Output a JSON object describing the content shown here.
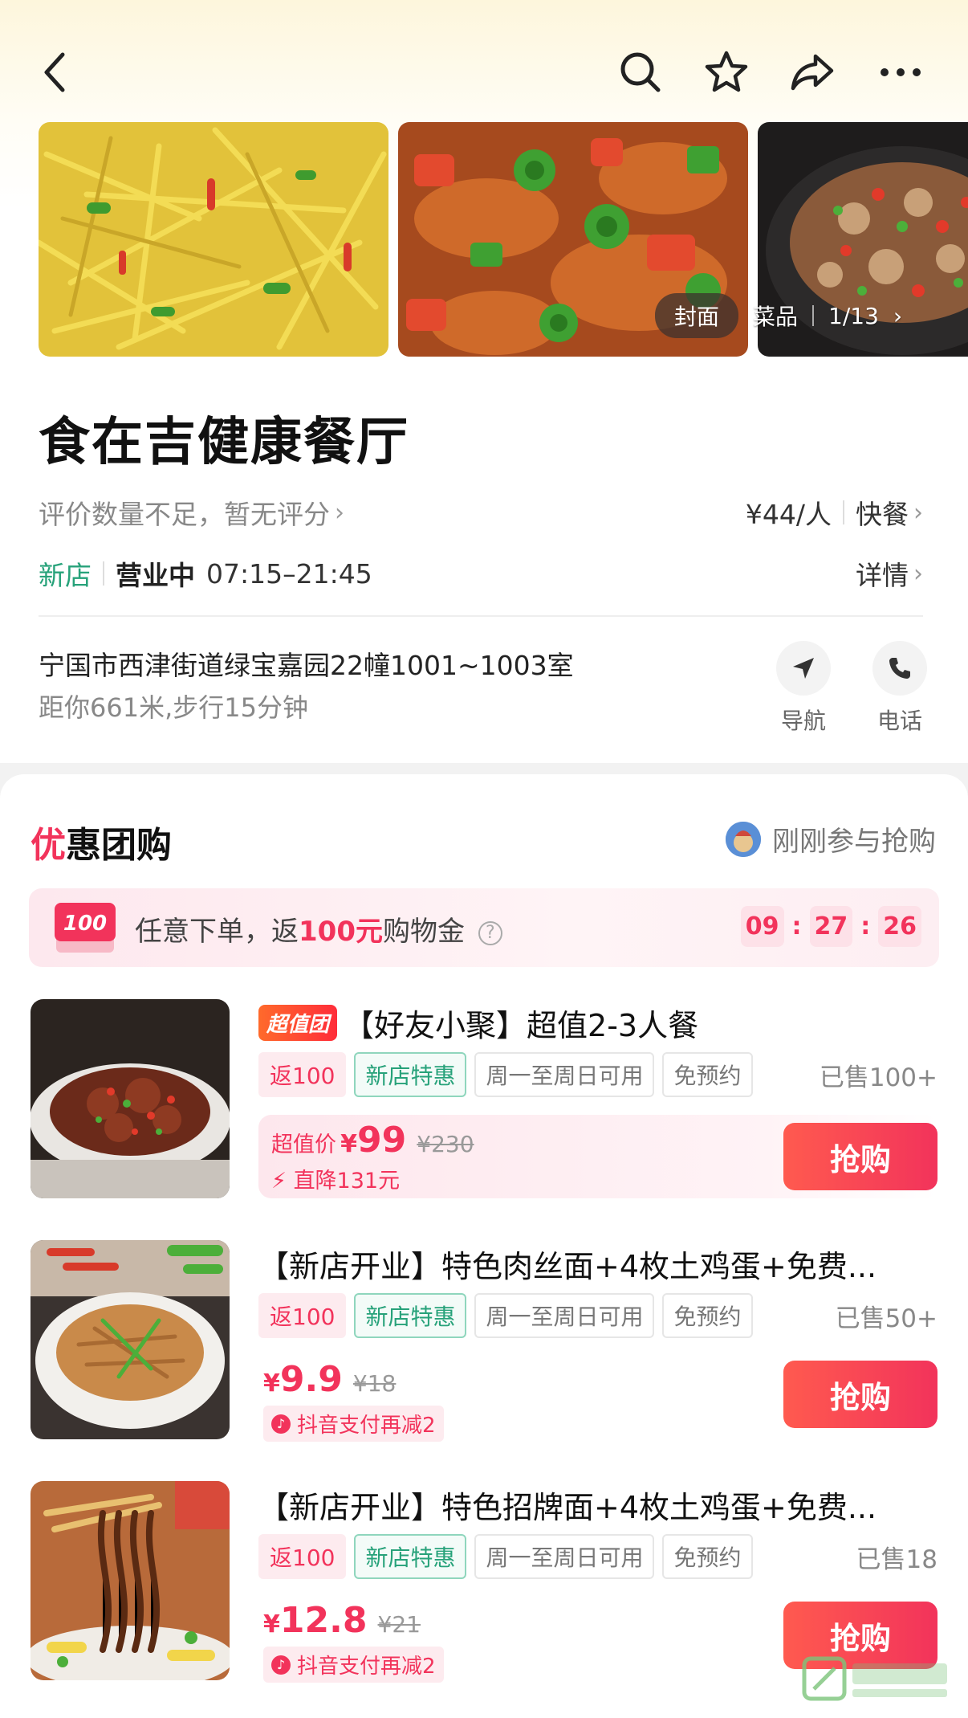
{
  "header": {
    "back_icon": "back-arrow-icon",
    "actions": [
      "search-icon",
      "star-icon",
      "share-icon",
      "more-icon"
    ]
  },
  "gallery": {
    "cover_label": "封面",
    "dishes_label": "菜品",
    "counter": "1/13"
  },
  "store": {
    "name": "食在吉健康餐厅",
    "rating_text": "评价数量不足，暂无评分",
    "price_per_person": "¥44/人",
    "category": "快餐",
    "new_badge": "新店",
    "status": "营业中",
    "hours": "07:15–21:45",
    "details_label": "详情",
    "address": "宁国市西津街道绿宝嘉园22幢1001~1003室",
    "distance": "距你661米,步行15分钟",
    "nav_label": "导航",
    "phone_label": "电话"
  },
  "deals_section": {
    "title_prefix": "优",
    "title_rest": "惠团购",
    "recent_text": "刚刚参与抢购",
    "promo": {
      "badge": "100",
      "text_before": "任意下单，返",
      "text_highlight": "100元",
      "text_after": "购物金",
      "help": "?",
      "timer": [
        "09",
        "27",
        "26"
      ]
    }
  },
  "deals": [
    {
      "badge": "超值团",
      "title": "【好友小聚】超值2-3人餐",
      "tags": [
        "返100",
        "新店特惠",
        "周一至周日可用",
        "免预约"
      ],
      "sold": "已售100+",
      "price_label": "超值价",
      "price_yen": "¥",
      "price": "99",
      "original": "¥230",
      "drop": "直降131元",
      "buy": "抢购"
    },
    {
      "title": "【新店开业】特色肉丝面+4枚土鸡蛋+免费...",
      "tags": [
        "返100",
        "新店特惠",
        "周一至周日可用",
        "免预约"
      ],
      "sold": "已售50+",
      "price_yen": "¥",
      "price": "9.9",
      "original": "¥18",
      "coupon": "抖音支付再减2",
      "buy": "抢购"
    },
    {
      "title": "【新店开业】特色招牌面+4枚土鸡蛋+免费...",
      "tags": [
        "返100",
        "新店特惠",
        "周一至周日可用",
        "免预约"
      ],
      "sold": "已售18",
      "price_yen": "¥",
      "price": "12.8",
      "original": "¥21",
      "coupon": "抖音支付再减2",
      "buy": "抢购"
    }
  ],
  "colors": {
    "accent": "#f2335b",
    "green": "#27a27a"
  }
}
